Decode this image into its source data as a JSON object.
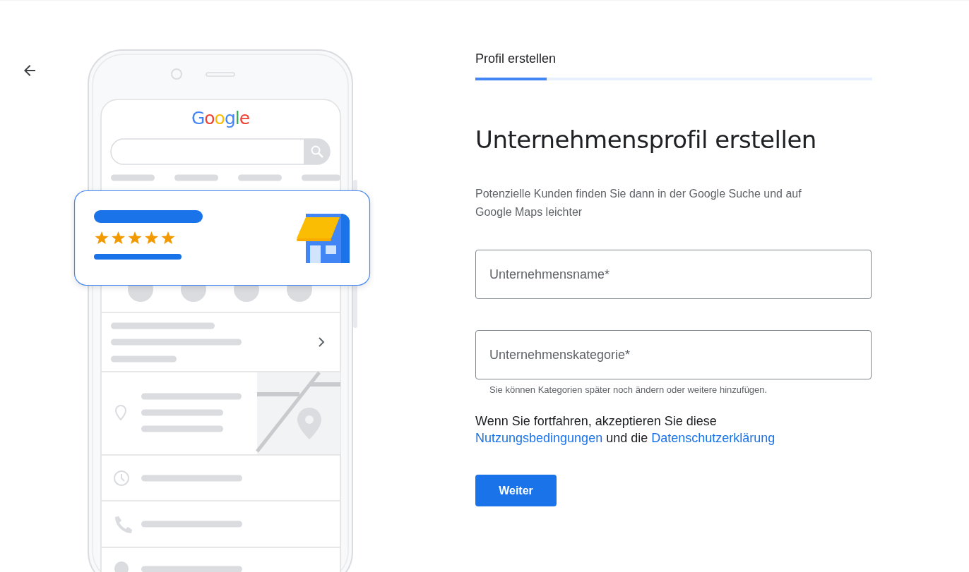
{
  "illustration": {
    "logo": "Google",
    "stars": 5
  },
  "step": {
    "label": "Profil erstellen",
    "level": 0.18
  },
  "title": "Unternehmensprofil erstellen",
  "description": "Potenzielle Kunden finden Sie dann in der Google Suche und auf Google Maps leichter",
  "fields": [
    {
      "placeholder": "Unternehmensname*"
    },
    {
      "placeholder": "Unternehmenskategorie*",
      "helper": "Sie können Kategorien später noch ändern oder weitere hinzufügen."
    }
  ],
  "consent": {
    "text": "Wenn Sie fortfahren, akzeptieren Sie diese",
    "link_1": "Nutzungsbedingungen",
    "middle": "und die",
    "link_2": "Datenschutzerklärung"
  },
  "buttons": [
    {
      "label": "Weiter",
      "kind": "primary"
    }
  ]
}
